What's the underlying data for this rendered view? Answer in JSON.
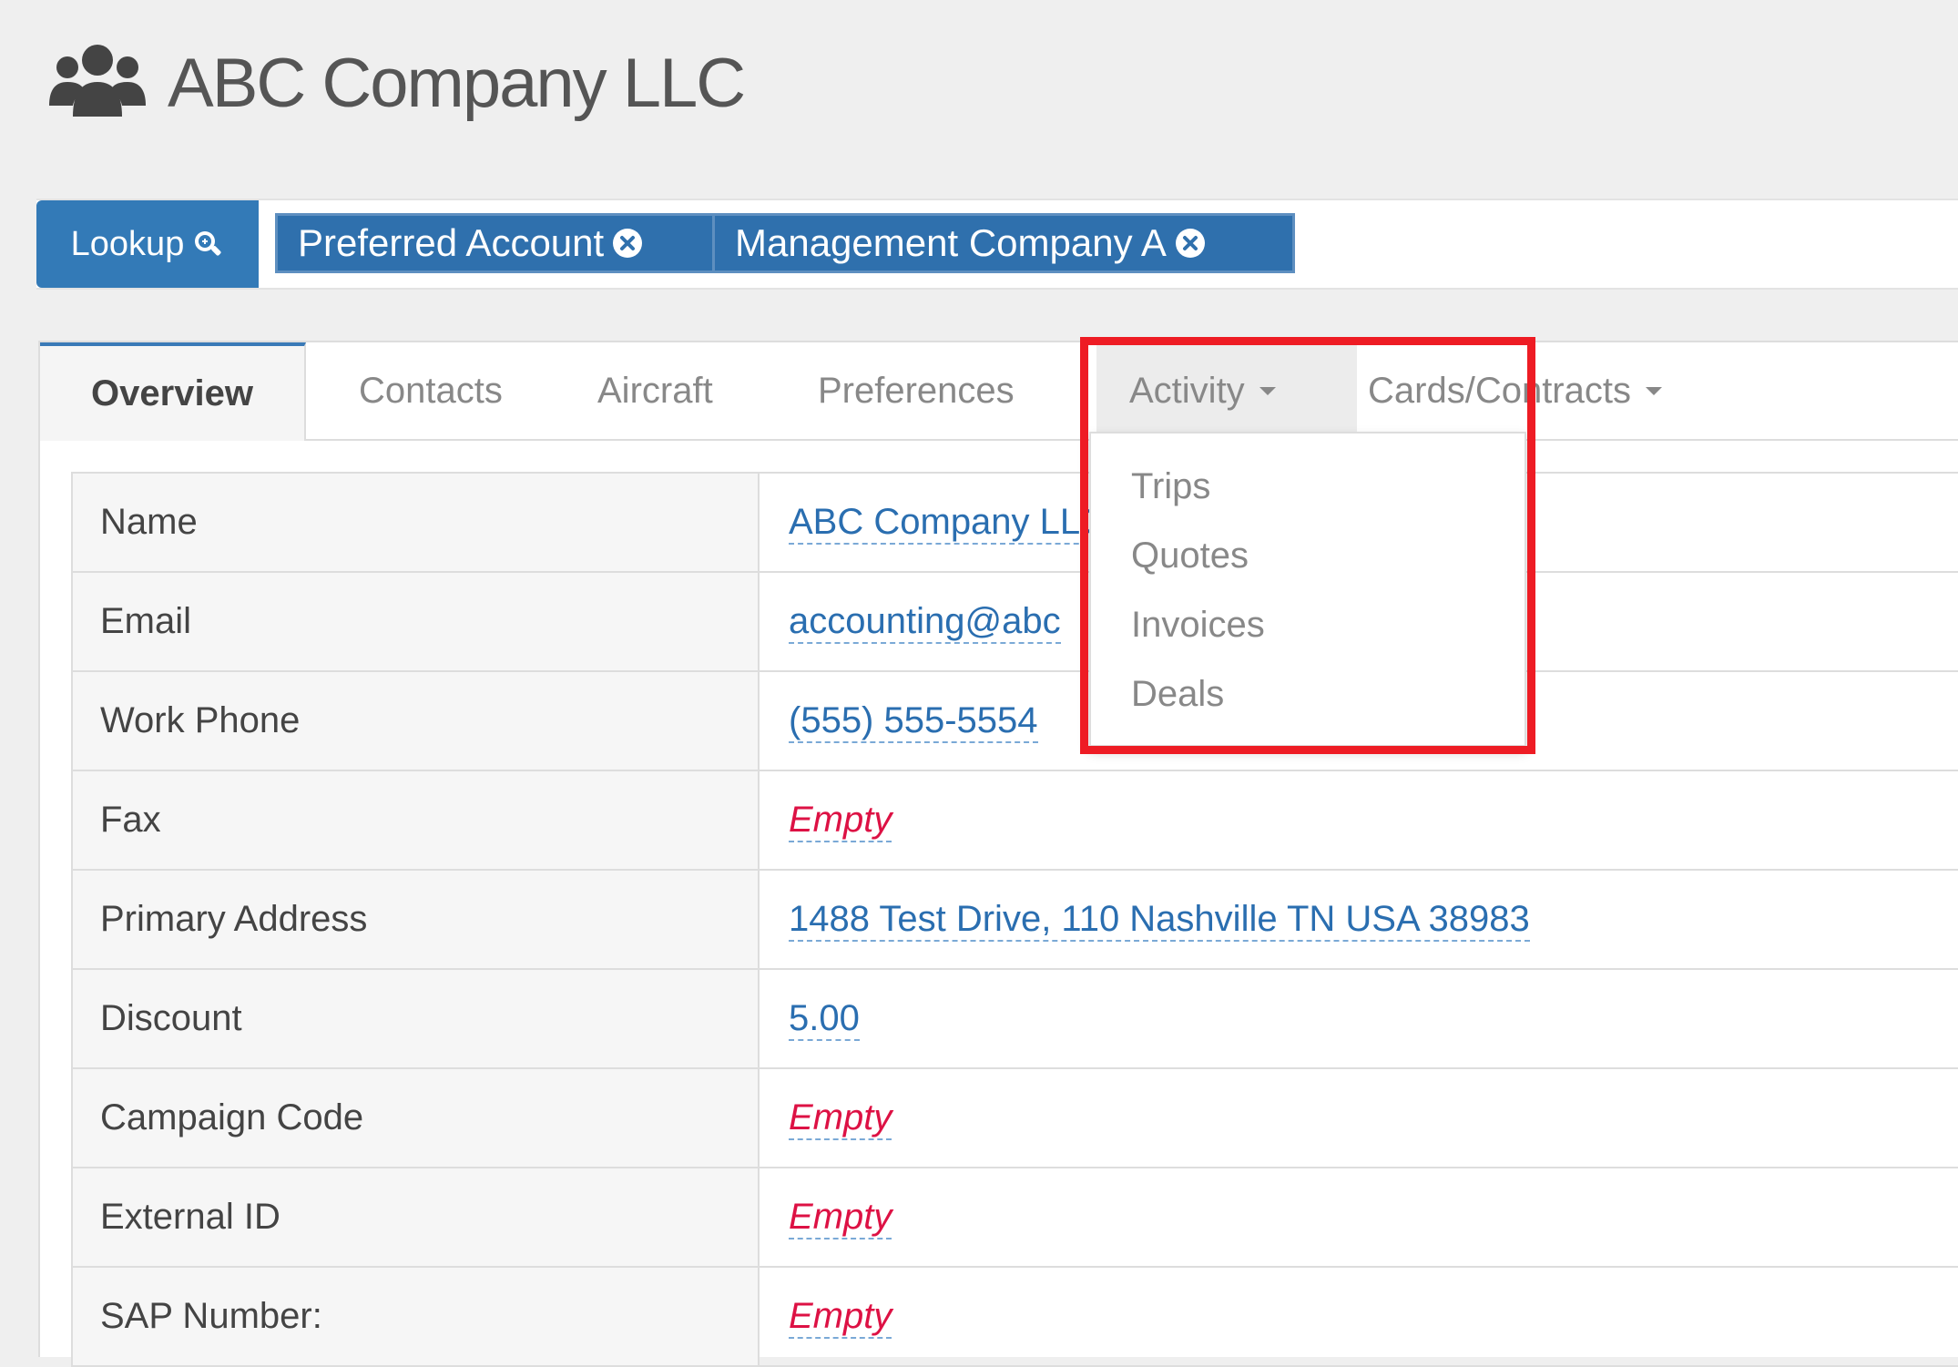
{
  "header": {
    "title": "ABC Company LLC",
    "icon": "users-group-icon"
  },
  "tagbar": {
    "lookup_label": "Lookup",
    "lookup_icon": "search-plus-icon",
    "tags": [
      {
        "label": "Preferred Account"
      },
      {
        "label": "Management Company A"
      }
    ]
  },
  "tabs": [
    {
      "label": "Overview",
      "active": true
    },
    {
      "label": "Contacts"
    },
    {
      "label": "Aircraft"
    },
    {
      "label": "Preferences"
    },
    {
      "label": "Activity",
      "dropdown": true,
      "open": true
    },
    {
      "label": "Cards/Contracts",
      "dropdown": true
    }
  ],
  "activity_menu": [
    "Trips",
    "Quotes",
    "Invoices",
    "Deals"
  ],
  "fields": [
    {
      "label": "Name",
      "value": "ABC Company LLC"
    },
    {
      "label": "Email",
      "value": "accounting@abc"
    },
    {
      "label": "Work Phone",
      "value": "(555) 555-5554"
    },
    {
      "label": "Fax",
      "value": "Empty",
      "empty": true
    },
    {
      "label": "Primary Address",
      "value": "1488 Test Drive, 110 Nashville TN USA 38983"
    },
    {
      "label": "Discount",
      "value": "5.00"
    },
    {
      "label": "Campaign Code",
      "value": "Empty",
      "empty": true
    },
    {
      "label": "External ID",
      "value": "Empty",
      "empty": true
    },
    {
      "label": "SAP Number:",
      "value": "Empty",
      "empty": true
    }
  ],
  "colors": {
    "accent": "#337ab7",
    "empty_text": "#dd1144",
    "highlight": "#ee1c24"
  }
}
